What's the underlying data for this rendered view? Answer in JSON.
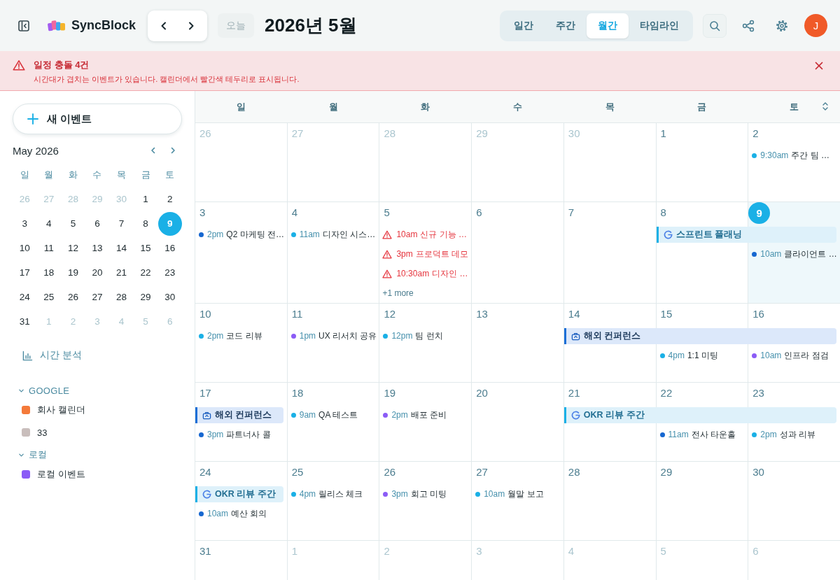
{
  "header": {
    "app_name": "SyncBlock",
    "today_button": {
      "label": "오늘",
      "disabled": true
    },
    "title": "2026년 5월",
    "views": [
      {
        "label": "일간",
        "selected": false
      },
      {
        "label": "주간",
        "selected": false
      },
      {
        "label": "월간",
        "selected": true
      },
      {
        "label": "타임라인",
        "selected": false
      }
    ],
    "avatar": {
      "initial": "J"
    }
  },
  "alert": {
    "title": "일정 충돌 4건",
    "message": "시간대가 겹치는 이벤트가 있습니다. 캘린더에서 빨간색 테두리로 표시됩니다."
  },
  "sidebar": {
    "new_event_label": "새 이벤트",
    "mini_calendar": {
      "title": "May 2026",
      "weekdays": [
        "일",
        "월",
        "화",
        "수",
        "목",
        "금",
        "토"
      ],
      "days": [
        {
          "label": "26",
          "outside": true,
          "selected": false
        },
        {
          "label": "27",
          "outside": true,
          "selected": false
        },
        {
          "label": "28",
          "outside": true,
          "selected": false
        },
        {
          "label": "29",
          "outside": true,
          "selected": false
        },
        {
          "label": "30",
          "outside": true,
          "selected": false
        },
        {
          "label": "1",
          "outside": false,
          "selected": false
        },
        {
          "label": "2",
          "outside": false,
          "selected": false
        },
        {
          "label": "3",
          "outside": false,
          "selected": false
        },
        {
          "label": "4",
          "outside": false,
          "selected": false
        },
        {
          "label": "5",
          "outside": false,
          "selected": false
        },
        {
          "label": "6",
          "outside": false,
          "selected": false
        },
        {
          "label": "7",
          "outside": false,
          "selected": false
        },
        {
          "label": "8",
          "outside": false,
          "selected": false
        },
        {
          "label": "9",
          "outside": false,
          "selected": true
        },
        {
          "label": "10",
          "outside": false,
          "selected": false
        },
        {
          "label": "11",
          "outside": false,
          "selected": false
        },
        {
          "label": "12",
          "outside": false,
          "selected": false
        },
        {
          "label": "13",
          "outside": false,
          "selected": false
        },
        {
          "label": "14",
          "outside": false,
          "selected": false
        },
        {
          "label": "15",
          "outside": false,
          "selected": false
        },
        {
          "label": "16",
          "outside": false,
          "selected": false
        },
        {
          "label": "17",
          "outside": false,
          "selected": false
        },
        {
          "label": "18",
          "outside": false,
          "selected": false
        },
        {
          "label": "19",
          "outside": false,
          "selected": false
        },
        {
          "label": "20",
          "outside": false,
          "selected": false
        },
        {
          "label": "21",
          "outside": false,
          "selected": false
        },
        {
          "label": "22",
          "outside": false,
          "selected": false
        },
        {
          "label": "23",
          "outside": false,
          "selected": false
        },
        {
          "label": "24",
          "outside": false,
          "selected": false
        },
        {
          "label": "25",
          "outside": false,
          "selected": false
        },
        {
          "label": "26",
          "outside": false,
          "selected": false
        },
        {
          "label": "27",
          "outside": false,
          "selected": false
        },
        {
          "label": "28",
          "outside": false,
          "selected": false
        },
        {
          "label": "29",
          "outside": false,
          "selected": false
        },
        {
          "label": "30",
          "outside": false,
          "selected": false
        },
        {
          "label": "31",
          "outside": false,
          "selected": false
        },
        {
          "label": "1",
          "outside": true,
          "selected": false
        },
        {
          "label": "2",
          "outside": true,
          "selected": false
        },
        {
          "label": "3",
          "outside": true,
          "selected": false
        },
        {
          "label": "4",
          "outside": true,
          "selected": false
        },
        {
          "label": "5",
          "outside": true,
          "selected": false
        },
        {
          "label": "6",
          "outside": true,
          "selected": false
        }
      ]
    },
    "analytics_link": "시간 분석",
    "groups": [
      {
        "label": "GOOGLE",
        "expanded": true,
        "calendars": [
          {
            "name": "회사 캘린더",
            "color": "#f47a3a"
          },
          {
            "name": "33",
            "color": "#c9bebc"
          }
        ]
      },
      {
        "label": "로컬",
        "expanded": true,
        "calendars": [
          {
            "name": "로컬 이벤트",
            "color": "#8b5cf6"
          }
        ]
      }
    ]
  },
  "calendar": {
    "weekdays": [
      "일",
      "월",
      "화",
      "수",
      "목",
      "금",
      "토"
    ],
    "weeks": [
      {
        "days": [
          {
            "date": "26",
            "outside": true,
            "today": false,
            "bar_continues": false
          },
          {
            "date": "27",
            "outside": true,
            "today": false,
            "bar_continues": false
          },
          {
            "date": "28",
            "outside": true,
            "today": false,
            "bar_continues": false
          },
          {
            "date": "29",
            "outside": true,
            "today": false,
            "bar_continues": false
          },
          {
            "date": "30",
            "outside": true,
            "today": false,
            "bar_continues": false
          },
          {
            "date": "1",
            "outside": false,
            "today": false,
            "bar_continues": false
          },
          {
            "date": "2",
            "outside": false,
            "today": false,
            "bar_continues": false,
            "items": [
              {
                "kind": "event",
                "time": "9:30am",
                "title": "주간 팀 …",
                "color": "#1ab0e6"
              }
            ]
          }
        ]
      },
      {
        "days": [
          {
            "date": "3",
            "outside": false,
            "today": false,
            "bar_continues": false,
            "items": [
              {
                "kind": "event",
                "time": "2pm",
                "title": "Q2 마케팅 전…",
                "color": "#1667d0"
              }
            ]
          },
          {
            "date": "4",
            "outside": false,
            "today": false,
            "bar_continues": false,
            "items": [
              {
                "kind": "event",
                "time": "11am",
                "title": "디자인 시스…",
                "color": "#1ab0e6"
              }
            ]
          },
          {
            "date": "5",
            "outside": false,
            "today": false,
            "bar_continues": false,
            "items": [
              {
                "kind": "conflict",
                "time": "10am",
                "title": "신규 기능 …"
              },
              {
                "kind": "conflict",
                "time": "3pm",
                "title": "프로덕트 데모"
              },
              {
                "kind": "conflict",
                "time": "10:30am",
                "title": "디자인 …"
              },
              {
                "kind": "more",
                "label": "+1 more"
              }
            ]
          },
          {
            "date": "6",
            "outside": false,
            "today": false,
            "bar_continues": false
          },
          {
            "date": "7",
            "outside": false,
            "today": false,
            "bar_continues": false
          },
          {
            "date": "8",
            "outside": false,
            "today": false,
            "bar_continues": false,
            "banner": {
              "kind": "google",
              "title": "스프린트 플래닝"
            }
          },
          {
            "date": "9",
            "outside": false,
            "today": true,
            "bar_continues": true,
            "items": [
              {
                "kind": "event",
                "time": "10am",
                "title": "클라이언트 …",
                "color": "#1667d0"
              }
            ]
          }
        ]
      },
      {
        "days": [
          {
            "date": "10",
            "outside": false,
            "today": false,
            "bar_continues": false,
            "items": [
              {
                "kind": "event",
                "time": "2pm",
                "title": "코드 리뷰",
                "color": "#1ab0e6"
              }
            ]
          },
          {
            "date": "11",
            "outside": false,
            "today": false,
            "bar_continues": false,
            "items": [
              {
                "kind": "event",
                "time": "1pm",
                "title": "UX 리서치 공유",
                "color": "#8b5cf6"
              }
            ]
          },
          {
            "date": "12",
            "outside": false,
            "today": false,
            "bar_continues": false,
            "items": [
              {
                "kind": "event",
                "time": "12pm",
                "title": "팀 런치",
                "color": "#1ab0e6"
              }
            ]
          },
          {
            "date": "13",
            "outside": false,
            "today": false,
            "bar_continues": false
          },
          {
            "date": "14",
            "outside": false,
            "today": false,
            "bar_continues": false,
            "banner": {
              "kind": "travel",
              "title": "해외 컨퍼런스"
            }
          },
          {
            "date": "15",
            "outside": false,
            "today": false,
            "bar_continues": true,
            "items": [
              {
                "kind": "event",
                "time": "4pm",
                "title": "1:1 미팅",
                "color": "#1ab0e6"
              }
            ]
          },
          {
            "date": "16",
            "outside": false,
            "today": false,
            "bar_continues": true,
            "items": [
              {
                "kind": "event",
                "time": "10am",
                "title": "인프라 점검",
                "color": "#8b5cf6"
              }
            ]
          }
        ]
      },
      {
        "days": [
          {
            "date": "17",
            "outside": false,
            "today": false,
            "bar_continues": false,
            "banner": {
              "kind": "travel",
              "title": "해외 컨퍼런스"
            },
            "items": [
              {
                "kind": "event",
                "time": "3pm",
                "title": "파트너사 콜",
                "color": "#1667d0"
              }
            ]
          },
          {
            "date": "18",
            "outside": false,
            "today": false,
            "bar_continues": false,
            "items": [
              {
                "kind": "event",
                "time": "9am",
                "title": "QA 테스트",
                "color": "#1ab0e6"
              }
            ]
          },
          {
            "date": "19",
            "outside": false,
            "today": false,
            "bar_continues": false,
            "items": [
              {
                "kind": "event",
                "time": "2pm",
                "title": "배포 준비",
                "color": "#8b5cf6"
              }
            ]
          },
          {
            "date": "20",
            "outside": false,
            "today": false,
            "bar_continues": false
          },
          {
            "date": "21",
            "outside": false,
            "today": false,
            "bar_continues": false,
            "banner": {
              "kind": "google",
              "title": "OKR 리뷰 주간"
            }
          },
          {
            "date": "22",
            "outside": false,
            "today": false,
            "bar_continues": true,
            "items": [
              {
                "kind": "event",
                "time": "11am",
                "title": "전사 타운홀",
                "color": "#1667d0"
              }
            ]
          },
          {
            "date": "23",
            "outside": false,
            "today": false,
            "bar_continues": true,
            "items": [
              {
                "kind": "event",
                "time": "2pm",
                "title": "성과 리뷰",
                "color": "#1ab0e6"
              }
            ]
          }
        ]
      },
      {
        "days": [
          {
            "date": "24",
            "outside": false,
            "today": false,
            "bar_continues": false,
            "banner": {
              "kind": "google",
              "title": "OKR 리뷰 주간"
            },
            "items": [
              {
                "kind": "event",
                "time": "10am",
                "title": "예산 회의",
                "color": "#1667d0"
              }
            ]
          },
          {
            "date": "25",
            "outside": false,
            "today": false,
            "bar_continues": false,
            "items": [
              {
                "kind": "event",
                "time": "4pm",
                "title": "릴리스 체크",
                "color": "#1ab0e6"
              }
            ]
          },
          {
            "date": "26",
            "outside": false,
            "today": false,
            "bar_continues": false,
            "items": [
              {
                "kind": "event",
                "time": "3pm",
                "title": "회고 미팅",
                "color": "#8b5cf6"
              }
            ]
          },
          {
            "date": "27",
            "outside": false,
            "today": false,
            "bar_continues": false,
            "items": [
              {
                "kind": "event",
                "time": "10am",
                "title": "월말 보고",
                "color": "#1ab0e6"
              }
            ]
          },
          {
            "date": "28",
            "outside": false,
            "today": false,
            "bar_continues": false
          },
          {
            "date": "29",
            "outside": false,
            "today": false,
            "bar_continues": false
          },
          {
            "date": "30",
            "outside": false,
            "today": false,
            "bar_continues": false
          }
        ]
      },
      {
        "days": [
          {
            "date": "31",
            "outside": false,
            "today": false,
            "bar_continues": false
          },
          {
            "date": "1",
            "outside": true,
            "today": false,
            "bar_continues": false
          },
          {
            "date": "2",
            "outside": true,
            "today": false,
            "bar_continues": false
          },
          {
            "date": "3",
            "outside": true,
            "today": false,
            "bar_continues": false
          },
          {
            "date": "4",
            "outside": true,
            "today": false,
            "bar_continues": false
          },
          {
            "date": "5",
            "outside": true,
            "today": false,
            "bar_continues": false
          },
          {
            "date": "6",
            "outside": true,
            "today": false,
            "bar_continues": false
          }
        ]
      }
    ]
  }
}
